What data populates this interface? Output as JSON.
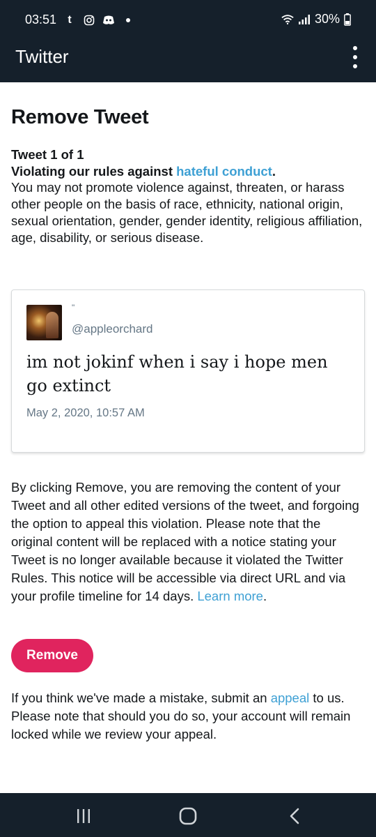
{
  "status_bar": {
    "time": "03:51",
    "battery": "30%",
    "icons": [
      "tumblr-icon",
      "instagram-icon",
      "discord-icon",
      "notification-dot-icon",
      "wifi-icon",
      "signal-icon",
      "battery-icon"
    ]
  },
  "app_bar": {
    "title": "Twitter",
    "menu_icon": "more-vertical-icon"
  },
  "main": {
    "title": "Remove Tweet",
    "tweet_count": "Tweet 1 of 1",
    "rule_prefix": "Violating our rules against ",
    "rule_link": "hateful conduct",
    "rule_suffix": ".",
    "rule_description": "You may not promote violence against, threaten, or harass other people on the basis of race, ethnicity, national origin, sexual orientation, gender, gender identity, religious affiliation, age, disability, or serious disease.",
    "notice_text": "By clicking Remove, you are removing the content of your Tweet and all other edited versions of the tweet, and forgoing the option to appeal this violation. Please note that the original content will be replaced with a notice stating your Tweet is no longer available because it violated the Twitter Rules. This notice will be accessible via direct URL and via your profile timeline for 14 days. ",
    "learn_more": "Learn more",
    "notice_end": ".",
    "remove_button": "Remove",
    "appeal_prefix": "If you think we've made a mistake, submit an ",
    "appeal_link": "appeal",
    "appeal_suffix": " to us. Please note that should you do so, your account will remain locked while we review your appeal."
  },
  "tweet": {
    "display_name": "\"",
    "handle": "@appleorchard",
    "text": "im not jokinf when i say i hope men go extinct",
    "timestamp": "May 2, 2020, 10:57 AM"
  },
  "nav_bar": {
    "icons": [
      "recent-apps-icon",
      "home-icon",
      "back-icon"
    ]
  },
  "colors": {
    "header_bg": "#15202b",
    "link": "#3ea0d4",
    "remove_button": "#e0245e",
    "muted_text": "#657786"
  }
}
